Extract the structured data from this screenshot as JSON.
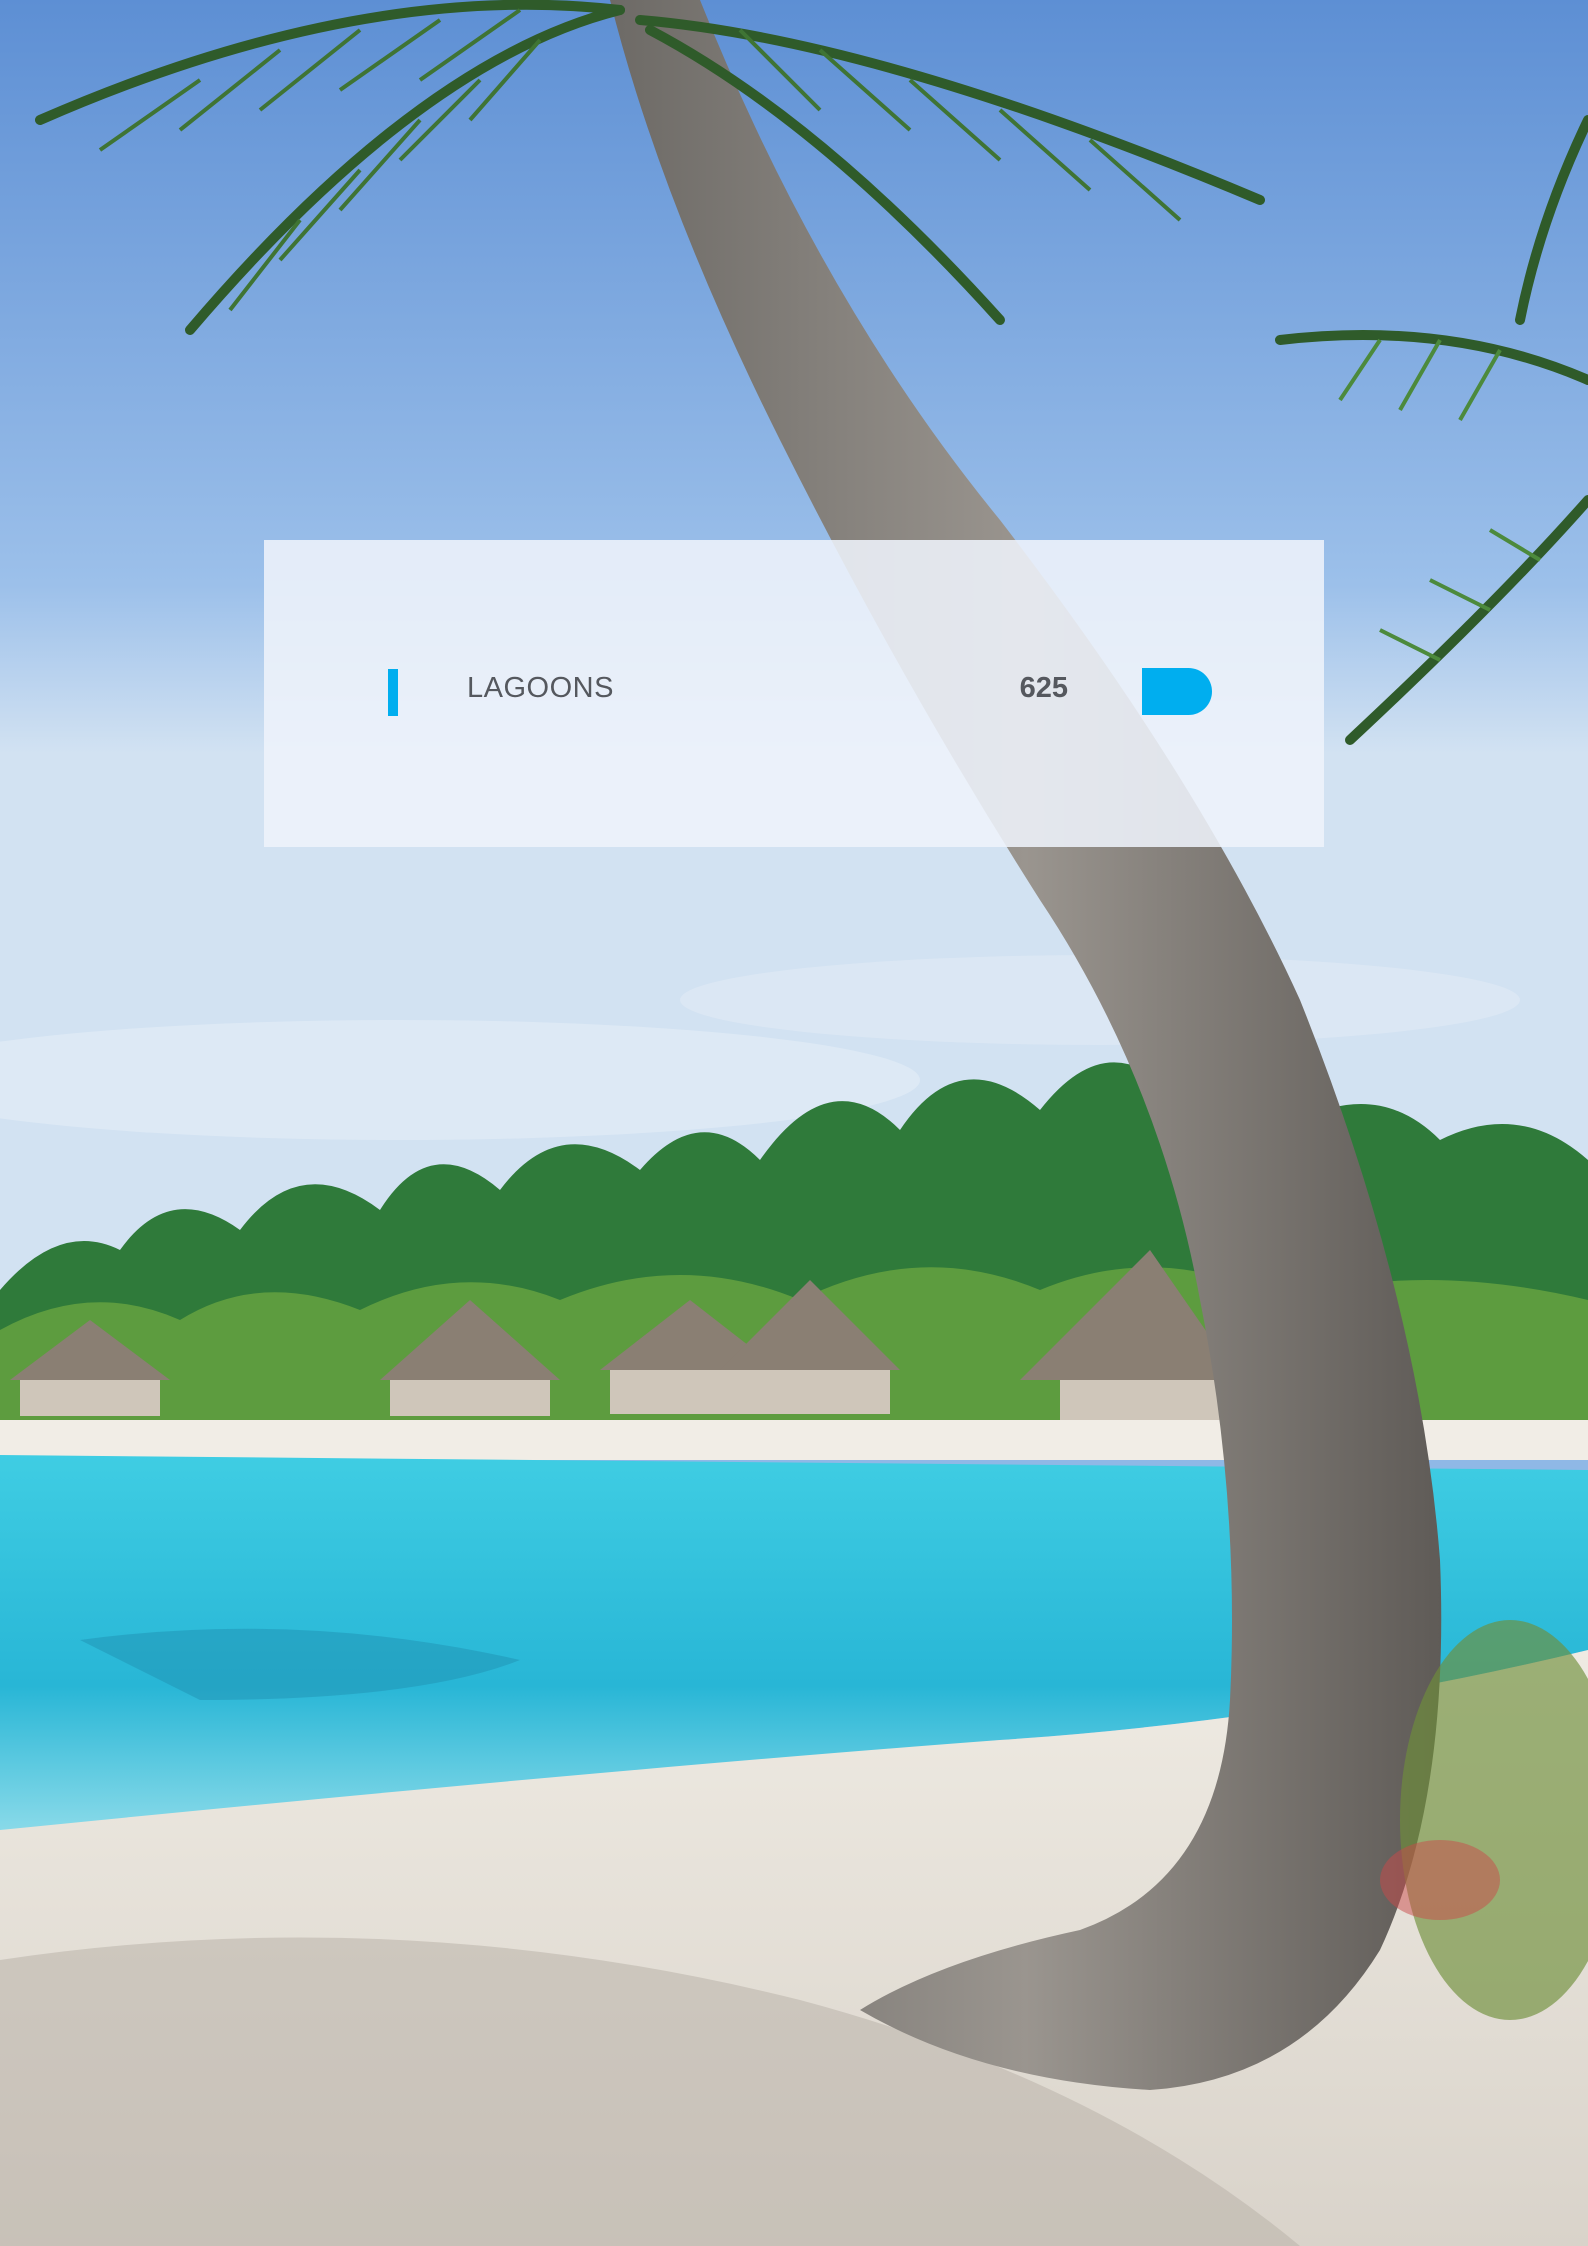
{
  "card": {
    "section_label": "LAGOONS",
    "page_number": "625"
  },
  "colors": {
    "accent": "#00aeef",
    "text": "#55585e",
    "card_bg": "#eef2fa",
    "sky": "#8fb8e6",
    "lagoon": "#35c4dc",
    "sand": "#e9e4dc"
  },
  "photo": {
    "icon": "tropical-lagoon-photo"
  }
}
